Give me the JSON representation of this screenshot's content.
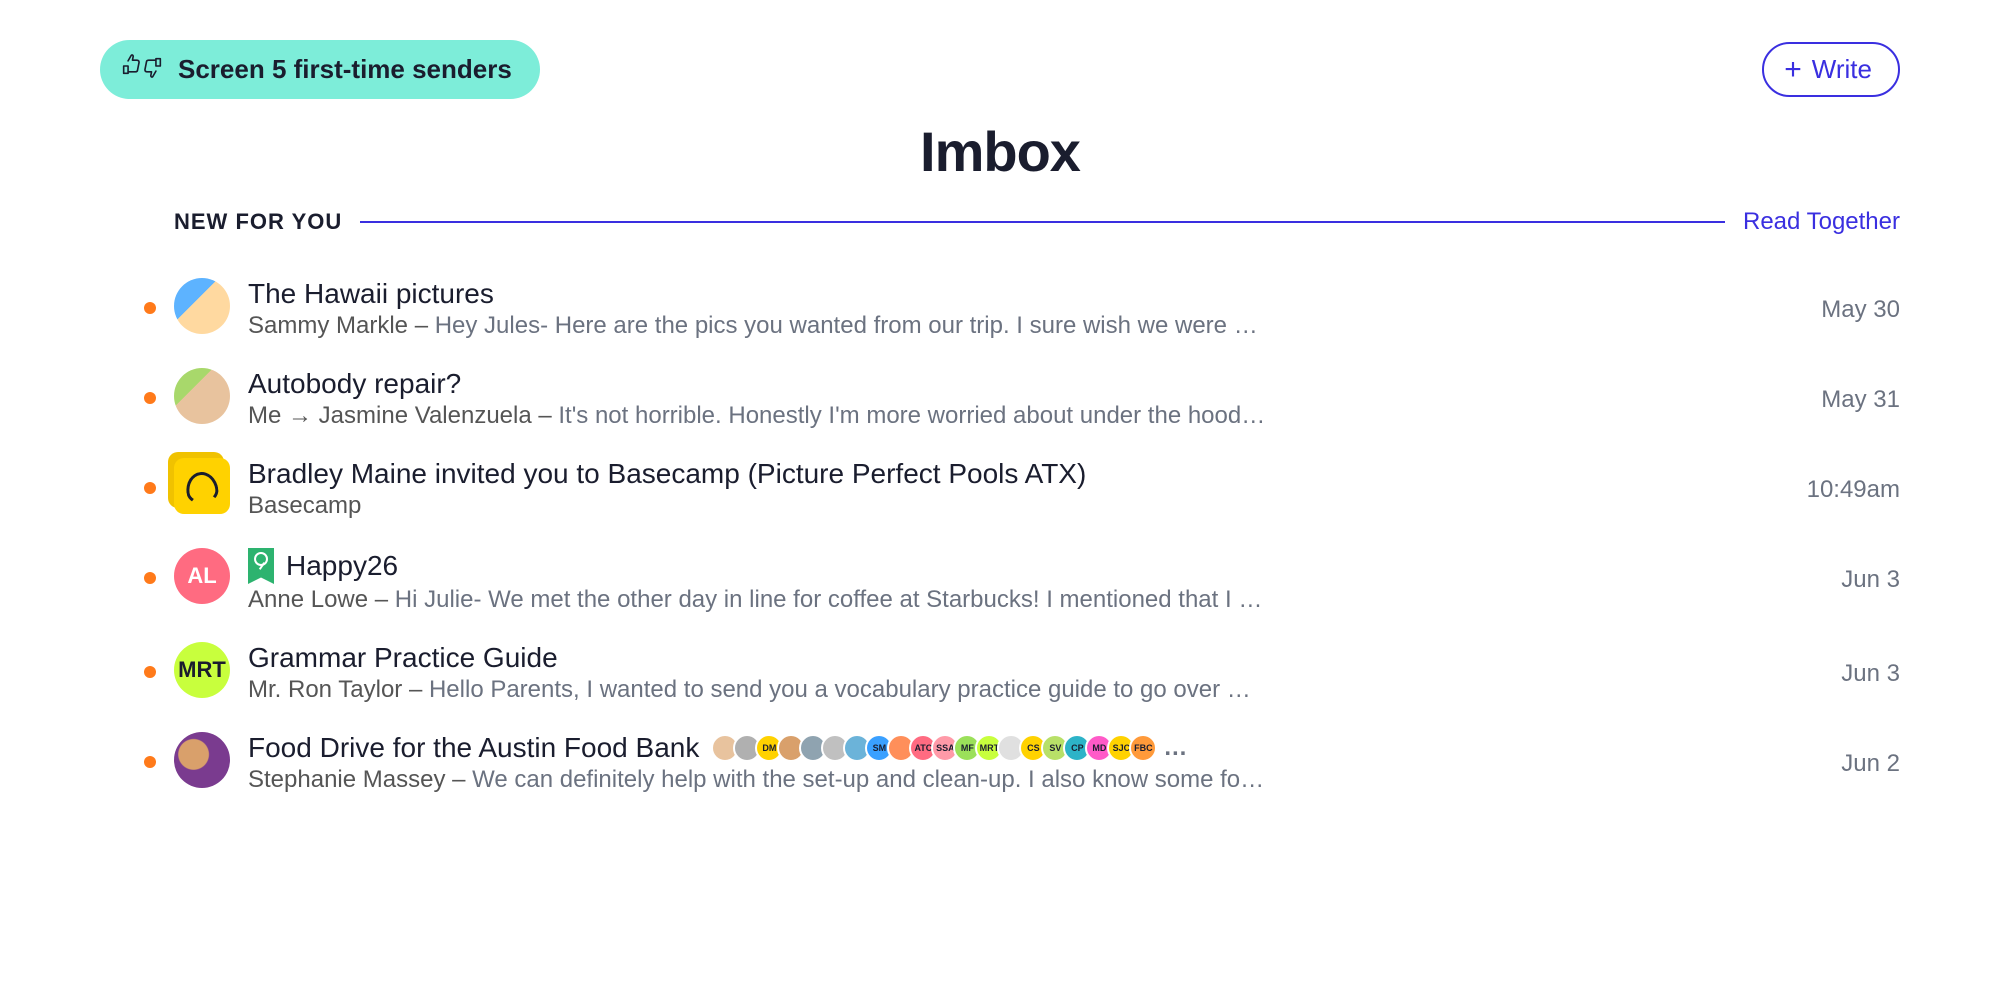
{
  "screener": {
    "label": "Screen 5 first-time senders"
  },
  "write_button": {
    "label": "Write"
  },
  "page_title": "Imbox",
  "section": {
    "label": "NEW FOR YOU",
    "link": "Read Together"
  },
  "emails": [
    {
      "subject": "The Hawaii pictures",
      "sender": "Sammy Markle",
      "preview": "Hey Jules- Here are the pics you wanted from our trip. I sure wish we were all ba…",
      "date": "May 30",
      "avatar_initials": "",
      "avatar_class": "av-photo1",
      "has_key": false,
      "from_me": false
    },
    {
      "subject": "Autobody repair?",
      "sender": "Jasmine Valenzuela",
      "preview": "It's not horrible. Honestly I'm more worried about under the hood of th…",
      "date": "May 31",
      "avatar_initials": "",
      "avatar_class": "av-photo2",
      "has_key": false,
      "from_me": true
    },
    {
      "subject": "Bradley Maine invited you to Basecamp (Picture Perfect Pools ATX)",
      "sender": "Basecamp",
      "preview": "",
      "date": "10:49am",
      "avatar_initials": "",
      "avatar_class": "av-basecamp square",
      "has_key": false,
      "from_me": false
    },
    {
      "subject": "Happy26",
      "sender": "Anne Lowe",
      "preview": "Hi Julie- We met the other day in line for coffee at Starbucks! I mentioned that I am…",
      "date": "Jun 3",
      "avatar_initials": "AL",
      "avatar_class": "av-al",
      "has_key": true,
      "from_me": false
    },
    {
      "subject": "Grammar Practice Guide",
      "sender": "Mr. Ron Taylor",
      "preview": "Hello Parents, I wanted to send you a vocabulary practice guide to go over with you…",
      "date": "Jun 3",
      "avatar_initials": "MRT",
      "avatar_class": "av-mrt",
      "has_key": false,
      "from_me": false
    },
    {
      "subject": "Food Drive for the Austin Food Bank",
      "sender": "Stephanie Massey",
      "preview": "We can definitely help with the set-up and clean-up. I also know some folks tha…",
      "date": "Jun 2",
      "avatar_initials": "",
      "avatar_class": "av-photo3",
      "has_key": false,
      "from_me": false,
      "participants": [
        {
          "label": "",
          "color": "#e8c39e"
        },
        {
          "label": "",
          "color": "#b0b0b0"
        },
        {
          "label": "DM",
          "color": "#ffd200"
        },
        {
          "label": "",
          "color": "#d9a06b"
        },
        {
          "label": "",
          "color": "#8fa3b0"
        },
        {
          "label": "",
          "color": "#c0c0c0"
        },
        {
          "label": "",
          "color": "#6bb3d9"
        },
        {
          "label": "SM",
          "color": "#3aa0ff"
        },
        {
          "label": "",
          "color": "#ff8f5a"
        },
        {
          "label": "ATC",
          "color": "#ff6b81"
        },
        {
          "label": "SSA",
          "color": "#ff9aa8"
        },
        {
          "label": "MF",
          "color": "#9be05a"
        },
        {
          "label": "MRT",
          "color": "#c8ff3d"
        },
        {
          "label": "",
          "color": "#e0e0e0"
        },
        {
          "label": "CS",
          "color": "#ffd200"
        },
        {
          "label": "SV",
          "color": "#b8e068"
        },
        {
          "label": "CP",
          "color": "#2db3c8"
        },
        {
          "label": "MD",
          "color": "#ff5ac8"
        },
        {
          "label": "SJC",
          "color": "#ffd200"
        },
        {
          "label": "FBC",
          "color": "#ff9a3a"
        }
      ]
    }
  ],
  "me_label": "Me"
}
